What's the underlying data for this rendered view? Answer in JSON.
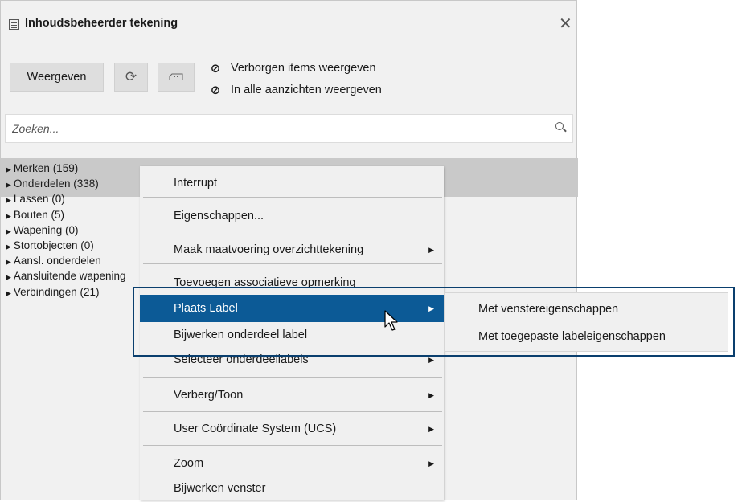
{
  "panel": {
    "title": "Inhoudsbeheerder tekening",
    "buttons": {
      "show_label": "Weergeven"
    },
    "options": {
      "hidden_items": "Verborgen items weergeven",
      "all_views": "In alle aanzichten weergeven"
    },
    "search": {
      "placeholder": "Zoeken..."
    },
    "tree": [
      {
        "label": "Merken (159)"
      },
      {
        "label": "Onderdelen (338)"
      },
      {
        "label": "Lassen (0)"
      },
      {
        "label": "Bouten (5)"
      },
      {
        "label": "Wapening (0)"
      },
      {
        "label": "Stortobjecten (0)"
      },
      {
        "label": "Aansl. onderdelen"
      },
      {
        "label": "Aansluitende wapening"
      },
      {
        "label": "Verbindingen (21)"
      }
    ]
  },
  "context_menu": {
    "items": [
      {
        "label": "Interrupt"
      },
      {
        "label": "Eigenschappen..."
      },
      {
        "label": "Maak maatvoering overzichttekening"
      },
      {
        "label": "Toevoegen associatieve opmerking"
      },
      {
        "label": "Plaats Label"
      },
      {
        "label": "Bijwerken onderdeel label"
      },
      {
        "label": "Selecteer onderdeellabels"
      },
      {
        "label": "Verberg/Toon"
      },
      {
        "label": "User Coördinate System (UCS)"
      },
      {
        "label": "Zoom"
      },
      {
        "label": "Bijwerken venster"
      }
    ]
  },
  "submenu": {
    "items": [
      {
        "label": "Met venstereigenschappen"
      },
      {
        "label": "Met toegepaste labeleigenschappen"
      }
    ]
  },
  "colors": {
    "highlight": "#0c5a96",
    "focus_outline": "#0a3f6e",
    "panel_bg": "#f1f1f1"
  }
}
